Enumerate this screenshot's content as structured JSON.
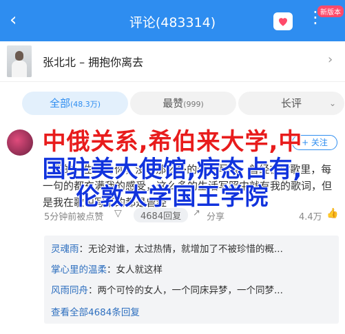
{
  "header": {
    "title": "评论(483314)",
    "back_icon": "back-arrow-icon",
    "badge": "新版本",
    "more_icon": "more-dots-icon",
    "accent": "#2e8df0"
  },
  "song": {
    "title": "张北北 – 拥抱你离去"
  },
  "tabs": [
    {
      "label": "全部",
      "count": "(48.3万)"
    },
    {
      "label": "最赞",
      "count": "(999)"
    },
    {
      "label": "长评",
      "count": ""
    }
  ],
  "comment": {
    "follow_label": "+ 关注",
    "text": "...我的一生只为你，没有那么多的生活写照，曾经在你歌里，每一句的都充满我的感受，这么多的生活写照中就有我的歌词，但是我在歌中写下的都是曾经",
    "time": "5分钟前被点赞",
    "reply_label": "4684回复",
    "share_label": "分享",
    "likes": "4.4万"
  },
  "overlay": {
    "line1": "中俄关系,希伯来大学,中",
    "line2": "国驻美大使馆,病态占有,",
    "line3": "伦敦大学国王学院"
  },
  "replies": [
    {
      "user": "灵魂雨",
      "text": "无论对谁，太过热情，就增加了不被珍惜的概..."
    },
    {
      "user": "掌心里的温柔",
      "text": "女人就这样"
    },
    {
      "user": "风雨同舟",
      "text": "两个可怜的女人，一个同床异梦，一个同梦..."
    }
  ],
  "view_all": "查看全部4684条回复"
}
